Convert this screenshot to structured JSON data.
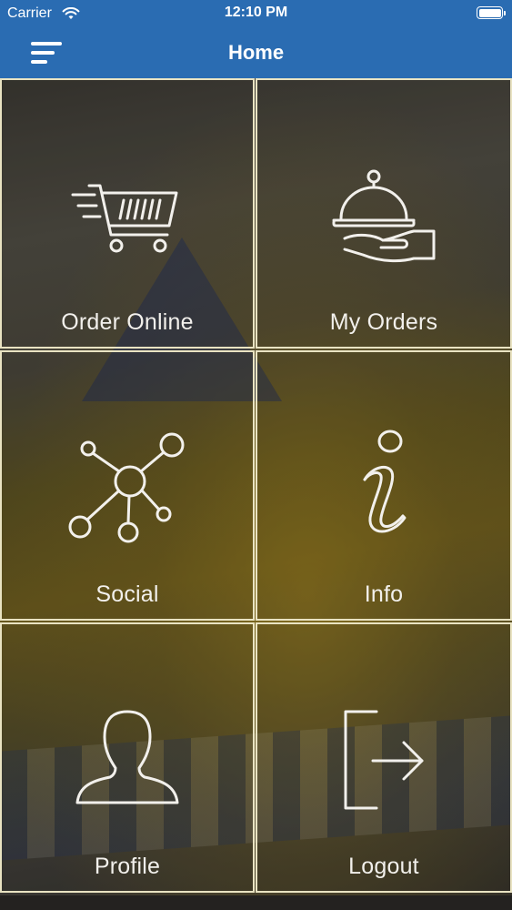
{
  "status_bar": {
    "carrier": "Carrier",
    "time": "12:10 PM",
    "wifi_icon": "wifi-icon",
    "battery_icon": "battery-icon"
  },
  "nav": {
    "title": "Home",
    "menu_icon": "menu-icon",
    "background_color": "#2a6cb2"
  },
  "tiles": [
    {
      "label": "Order Online",
      "icon": "shopping-cart-icon"
    },
    {
      "label": "My Orders",
      "icon": "serving-cloche-icon"
    },
    {
      "label": "Social",
      "icon": "network-nodes-icon"
    },
    {
      "label": "Info",
      "icon": "info-icon"
    },
    {
      "label": "Profile",
      "icon": "user-profile-icon"
    },
    {
      "label": "Logout",
      "icon": "logout-icon"
    }
  ],
  "colors": {
    "tile_border": "#e9e3c2",
    "label_text": "#f2f0ec"
  }
}
